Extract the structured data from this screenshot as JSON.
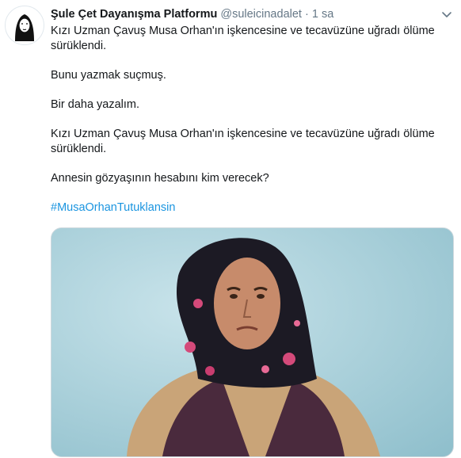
{
  "tweet": {
    "display_name": "Şule Çet Dayanışma Platformu",
    "handle": "@suleicinadalet",
    "separator": "·",
    "time": "1 sa",
    "paragraphs": [
      "Kızı Uzman Çavuş Musa Orhan'ın işkencesine ve tecavüzüne uğradı ölüme sürüklendi.",
      "Bunu yazmak suçmuş.",
      "Bir daha yazalım.",
      "Kızı Uzman Çavuş Musa Orhan'ın işkencesine ve tecavüzüne uğradı ölüme sürüklendi.",
      "Annesin gözyaşının hesabını kim verecek?"
    ],
    "hashtag": "#MusaOrhanTutuklansin"
  },
  "icons": {
    "caret": "chevron-down-icon",
    "avatar": "avatar"
  },
  "colors": {
    "link": "#1b95e0",
    "muted": "#657786",
    "text": "#14171a",
    "photo_background": "#a8cfd8"
  }
}
